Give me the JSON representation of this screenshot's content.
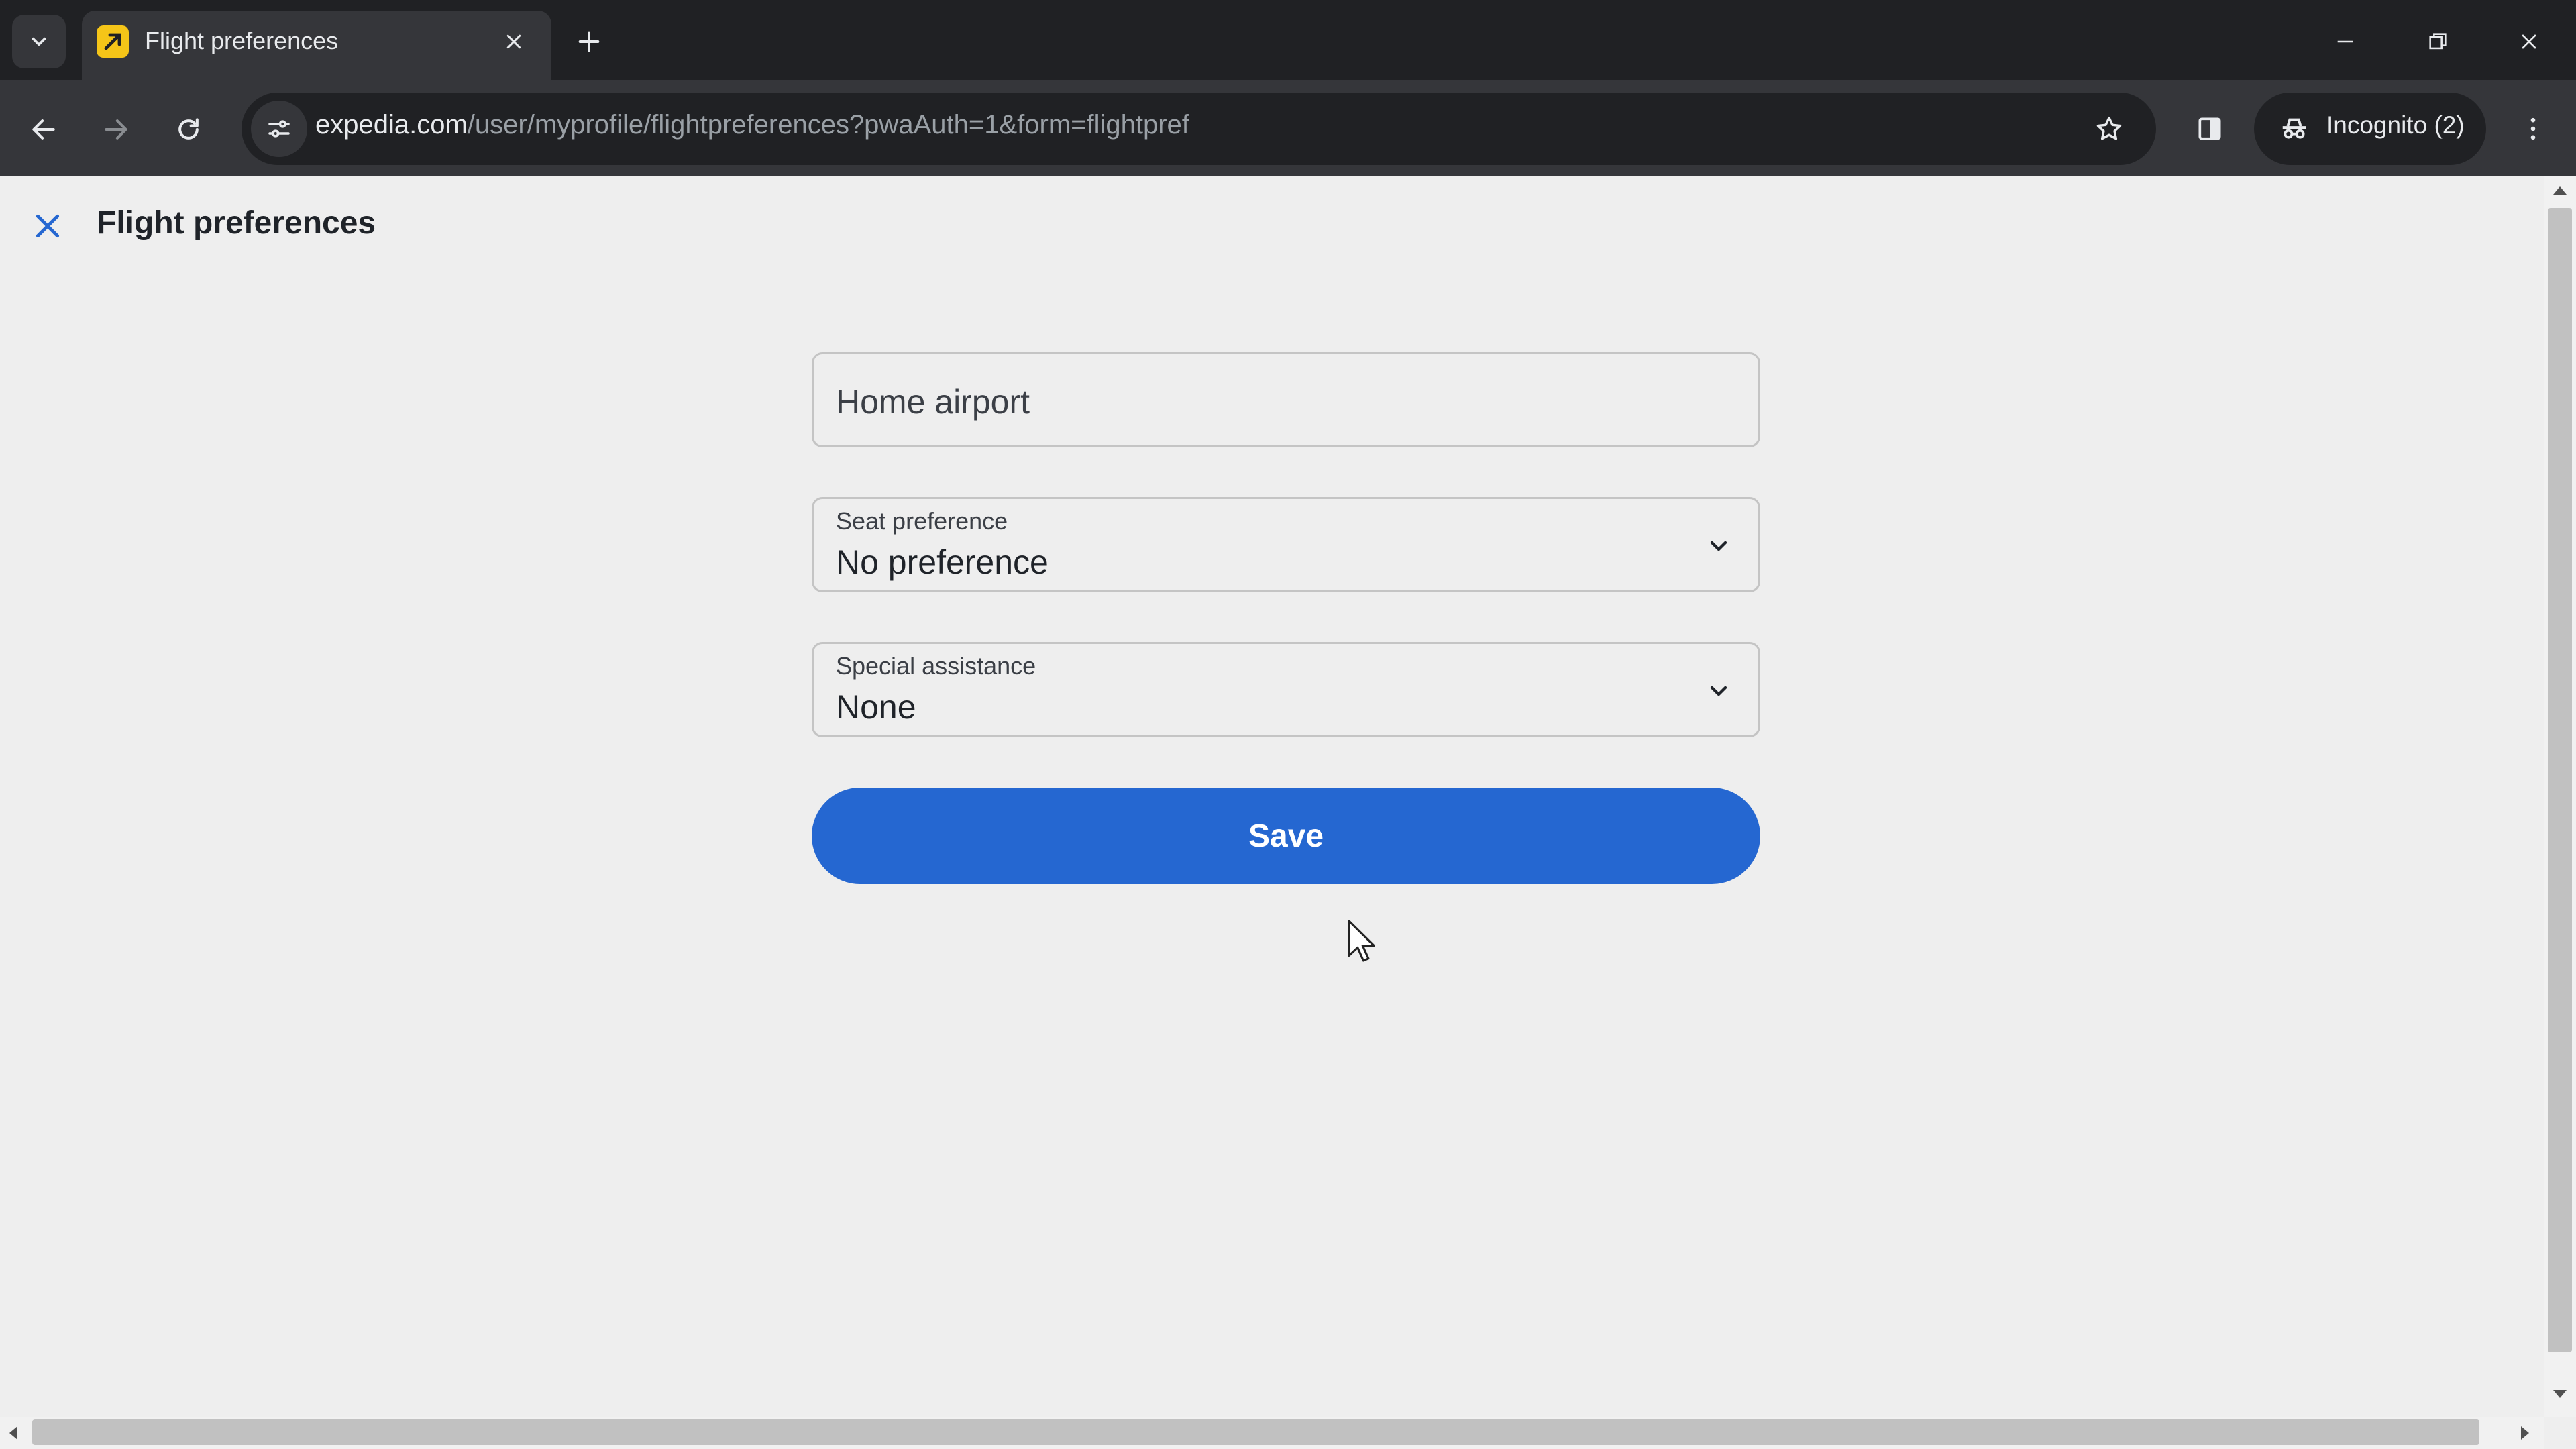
{
  "browser": {
    "tab_title": "Flight preferences",
    "url_host": "expedia.com",
    "url_path": "/user/myprofile/flightpreferences?pwaAuth=1&form=flightpref",
    "incognito_label": "Incognito (2)"
  },
  "page": {
    "title": "Flight preferences",
    "home_airport": {
      "placeholder": "Home airport",
      "value": ""
    },
    "seat_preference": {
      "label": "Seat preference",
      "value": "No preference"
    },
    "special_assistance": {
      "label": "Special assistance",
      "value": "None"
    },
    "save_label": "Save"
  },
  "colors": {
    "accent": "#2567d1",
    "close_icon": "#2567d1",
    "favicon": "#f5c518"
  },
  "icons": [
    "tab-list-icon",
    "expedia-favicon",
    "close-tab-icon",
    "new-tab-icon",
    "minimize-icon",
    "restore-icon",
    "close-window-icon",
    "back-icon",
    "forward-icon",
    "reload-icon",
    "site-info-icon",
    "bookmark-star-icon",
    "side-panel-icon",
    "incognito-icon",
    "menu-icon",
    "close-icon",
    "chevron-down-icon",
    "cursor-icon"
  ]
}
